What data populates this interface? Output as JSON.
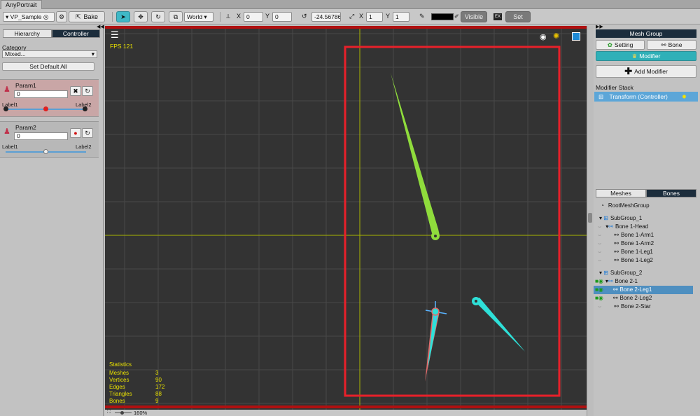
{
  "window": {
    "tab_title": "AnyPortrait"
  },
  "toolbar": {
    "target_name": "VP_Sample",
    "bake_label": "Bake",
    "space_select": "World",
    "pos_x_label": "X",
    "pos_x": "0",
    "pos_y_label": "Y",
    "pos_y": "0",
    "rotation": "-24.56786",
    "scale_x_label": "X",
    "scale_x": "1",
    "scale_y_label": "Y",
    "scale_y": "1",
    "color_value": "#000000",
    "visible_label": "Visible",
    "set_label": "Set"
  },
  "left_panel": {
    "tabs": [
      {
        "label": "Hierarchy"
      },
      {
        "label": "Controller"
      }
    ],
    "category_label": "Category",
    "category_value": "Mixed...",
    "set_default_all": "Set Default All",
    "params": [
      {
        "name": "Param1",
        "value": "0",
        "label_left": "Label1",
        "label_right": "Label2",
        "slider_value": 0.5
      },
      {
        "name": "Param2",
        "value": "0",
        "label_left": "Label1",
        "label_right": "Label2",
        "slider_value": 0.5
      }
    ]
  },
  "viewport": {
    "fps_text": "FPS 121",
    "statistics": {
      "title": "Statistics",
      "rows": [
        {
          "label": "Meshes",
          "value": "3"
        },
        {
          "label": "Vertices",
          "value": "90"
        },
        {
          "label": "Edges",
          "value": "172"
        },
        {
          "label": "Triangles",
          "value": "88"
        },
        {
          "label": "Bones",
          "value": "9"
        }
      ]
    },
    "zoom_text": "160%",
    "colors": {
      "background": "#333333",
      "grid": "#4a4a4a",
      "selection_box": "#e8202a",
      "crosshair": "#a9b400",
      "green_mesh": "#8fdc3c",
      "cyan_mesh": "#2ee0d8",
      "pink_mesh": "#e06a6a"
    }
  },
  "right_panel": {
    "mesh_group_header": "Mesh Group",
    "setting_label": "Setting",
    "bone_label": "Bone",
    "modifier_label": "Modifier",
    "add_modifier_label": "Add Modifier",
    "modifier_stack_label": "Modifier Stack",
    "modifier_item": "Transform (Controller)",
    "bottom_tabs": [
      {
        "label": "Meshes"
      },
      {
        "label": "Bones"
      }
    ],
    "tree": [
      {
        "label": "RootMeshGroup",
        "kind": "root"
      },
      {
        "label": "SubGroup_1",
        "kind": "group"
      },
      {
        "label": "Bone 1-Head",
        "kind": "bone-parent"
      },
      {
        "label": "Bone 1-Arm1",
        "kind": "bone"
      },
      {
        "label": "Bone 1-Arm2",
        "kind": "bone"
      },
      {
        "label": "Bone 1-Leg1",
        "kind": "bone"
      },
      {
        "label": "Bone 1-Leg2",
        "kind": "bone"
      },
      {
        "label": "SubGroup_2",
        "kind": "group"
      },
      {
        "label": "Bone 2-1",
        "kind": "bone-parent"
      },
      {
        "label": "Bone 2-Leg1",
        "kind": "bone",
        "selected": true
      },
      {
        "label": "Bone 2-Leg2",
        "kind": "bone"
      },
      {
        "label": "Bone 2-Star",
        "kind": "bone"
      }
    ]
  }
}
